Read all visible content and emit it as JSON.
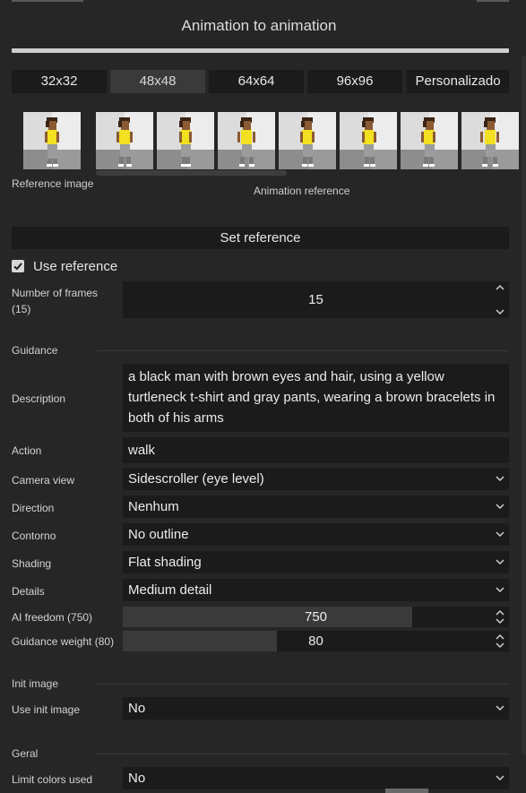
{
  "panel": {
    "title": "Animation to animation"
  },
  "sizes": [
    {
      "label": "32x32"
    },
    {
      "label": "48x48"
    },
    {
      "label": "64x64"
    },
    {
      "label": "96x96"
    },
    {
      "label": "Personalizado"
    }
  ],
  "reference": {
    "caption": "Reference image"
  },
  "animation": {
    "caption": "Animation reference",
    "visible_frames": 7
  },
  "actions": {
    "set_reference_label": "Set reference"
  },
  "use_reference": {
    "label": "Use reference",
    "checked": true
  },
  "frames": {
    "label": "Number of frames (15)",
    "value": "15"
  },
  "guidance": {
    "header": "Guidance",
    "description_label": "Description",
    "description_value": "a black man with brown eyes and hair, using a yellow turtleneck t-shirt and gray pants, wearing a brown bracelets in both of his arms",
    "action_label": "Action",
    "action_value": "walk",
    "camera_label": "Camera view",
    "camera_value": "Sidescroller (eye level)",
    "direction_label": "Direction",
    "direction_value": "Nenhum",
    "outline_label": "Contorno",
    "outline_value": "No outline",
    "shading_label": "Shading",
    "shading_value": "Flat shading",
    "details_label": "Details",
    "details_value": "Medium detail",
    "ai_freedom_label": "AI freedom (750)",
    "ai_freedom_value": "750",
    "ai_freedom_fraction": 0.75,
    "guidance_weight_label": "Guidance weight (80)",
    "guidance_weight_value": "80",
    "guidance_weight_fraction": 0.4
  },
  "init": {
    "header": "Init image",
    "use_init_label": "Use init image",
    "use_init_value": "No"
  },
  "general": {
    "header": "Geral",
    "limit_colors_label": "Limit colors used",
    "limit_colors_value": "No"
  },
  "colors": {
    "background": "#262626",
    "field": "#1b1b1b",
    "shirt": "#f2e021",
    "skin": "#8a5a33",
    "hair": "#3b2414"
  }
}
